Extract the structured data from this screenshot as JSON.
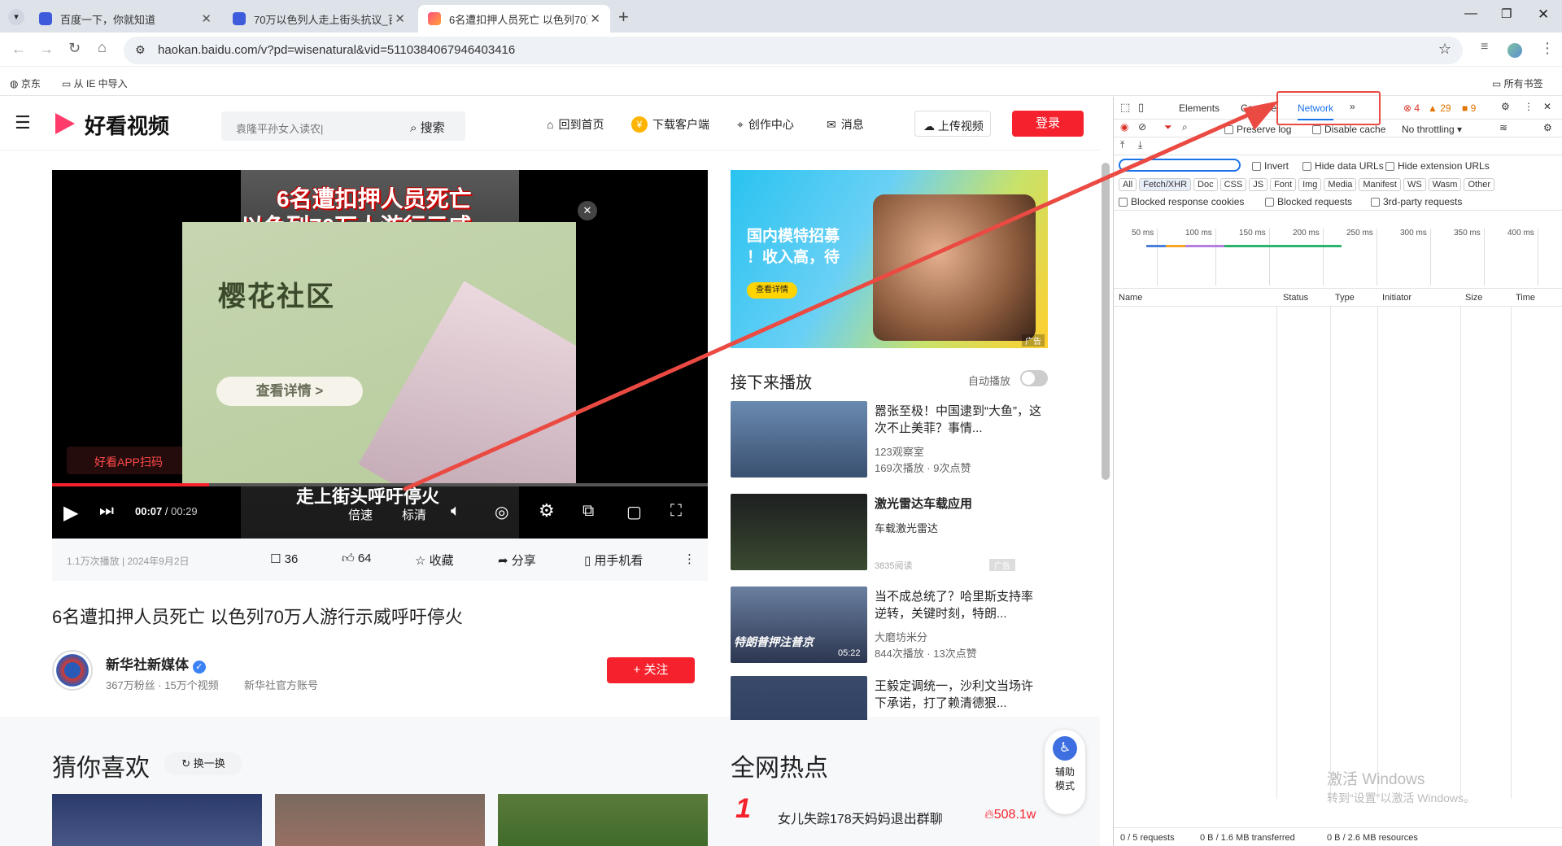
{
  "tabs": [
    {
      "title": "百度一下，你就知道"
    },
    {
      "title": "70万以色列人走上街头抗议_百"
    },
    {
      "title": "6名遭扣押人员死亡 以色列70万"
    }
  ],
  "address": "haokan.baidu.com/v?pd=wisenatural&vid=5110384067946403416",
  "bookmarks": {
    "jd": "京东",
    "ie": "从 IE 中导入",
    "all": "所有书签"
  },
  "header": {
    "logo": "好看视频",
    "search_placeholder": "袁隆平孙女入读农|",
    "search_btn": "搜索",
    "home": "回到首页",
    "download": "下载客户端",
    "create": "创作中心",
    "msg": "消息",
    "upload": "上传视频",
    "login": "登录"
  },
  "player": {
    "title_overlay": "6名遭扣押人员死亡",
    "title_overlay2": "以色列70万人游行示威",
    "subtitle": "走上街头呼吁停火",
    "qr_label": "好看APP扫码",
    "time_current": "00:07",
    "time_total": "00:29",
    "speed": "倍速",
    "quality": "标清",
    "progress": 0.24,
    "ad_title": "樱花社区",
    "ad_button": "查看详情 >"
  },
  "video_meta": {
    "stats": "1.1万次播放 | 2024年9月2日",
    "comments": "36",
    "likes": "64",
    "fav": "收藏",
    "share": "分享",
    "phone": "用手机看"
  },
  "video_title": "6名遭扣押人员死亡 以色列70万人游行示威呼吁停火",
  "author": {
    "name": "新华社新媒体",
    "info": "367万粉丝 · 15万个视频",
    "tag": "新华社官方账号",
    "follow": "+ 关注"
  },
  "guess": {
    "title": "猜你喜欢",
    "refresh": "换一换"
  },
  "hot": {
    "title": "全网热点",
    "item_rank": "1",
    "item_text": "女儿失踪178天妈妈退出群聊",
    "item_count": "508.1w"
  },
  "assist": "辅助模式",
  "banner": {
    "line1": "国内模特招募",
    "line2": "！收入高，待",
    "btn": "查看详情",
    "ad": "广告"
  },
  "next": {
    "title": "接下来播放",
    "autoplay": "自动播放"
  },
  "recs": [
    {
      "title": "嚣张至极！中国逮到“大鱼”，这次不止美菲？事情...",
      "author": "123观察室",
      "stats": "169次播放 · 9次点赞"
    },
    {
      "title": "激光雷达车载应用",
      "author": "车载激光雷达",
      "stats": "3835阅读",
      "ad": "广告"
    },
    {
      "title": "当不成总统了？哈里斯支持率逆转，关键时刻，特朗...",
      "author": "大磨坊米分",
      "stats": "844次播放 · 13次点赞",
      "thumb_text": "特朗普押注普京",
      "duration": "05:22"
    },
    {
      "title": "王毅定调统一，沙利文当场许下承诺，打了赖清德狠...",
      "author": "",
      "stats": ""
    }
  ],
  "devtools": {
    "tabs": [
      "Elements",
      "Console",
      "Network"
    ],
    "errors": "4",
    "warnings": "29",
    "issues": "9",
    "preserve": "Preserve log",
    "disable_cache": "Disable cache",
    "throttle": "No throttling",
    "invert": "Invert",
    "hide_data": "Hide data URLs",
    "hide_ext": "Hide extension URLs",
    "filters": [
      "All",
      "Fetch/XHR",
      "Doc",
      "CSS",
      "JS",
      "Font",
      "Img",
      "Media",
      "Manifest",
      "WS",
      "Wasm",
      "Other"
    ],
    "blocked_cookies": "Blocked response cookies",
    "blocked_req": "Blocked requests",
    "third_party": "3rd-party requests",
    "ticks": [
      "50 ms",
      "100 ms",
      "150 ms",
      "200 ms",
      "250 ms",
      "300 ms",
      "350 ms",
      "400 ms"
    ],
    "columns": [
      "Name",
      "Status",
      "Type",
      "Initiator",
      "Size",
      "Time"
    ],
    "status_requests": "0 / 5 requests",
    "status_transferred": "0 B / 1.6 MB transferred",
    "status_resources": "0 B / 2.6 MB resources",
    "watermark1": "激活 Windows",
    "watermark2": "转到“设置”以激活 Windows。"
  },
  "colors": {
    "accent": "#f5222d",
    "annotation": "#ea4a42",
    "link": "#1a73e8"
  }
}
